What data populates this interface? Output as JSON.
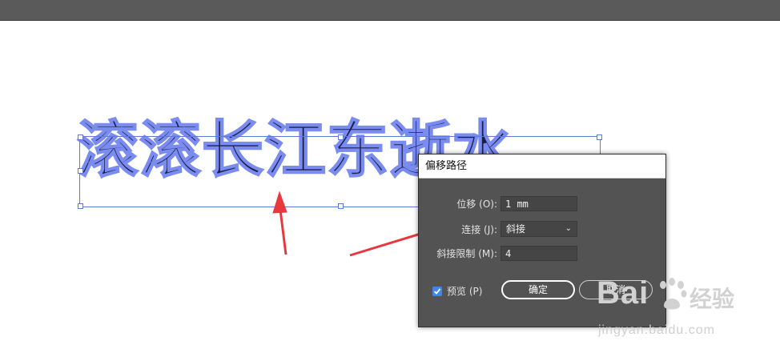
{
  "canvas": {
    "art_text": "滚滚长江东逝水"
  },
  "dialog": {
    "title": "偏移路径",
    "offset": {
      "label": "位移 (O):",
      "value": "1 mm"
    },
    "join": {
      "label": "连接 (J):",
      "value": "斜接"
    },
    "miter_limit": {
      "label": "斜接限制 (M):",
      "value": "4"
    },
    "preview": {
      "label": "预览 (P)",
      "checked": true
    },
    "ok_label": "确定",
    "cancel_label": "取消"
  },
  "watermark": {
    "brand": "Bai",
    "brand_cn": "经验",
    "url": "jingyan.baidu.com"
  },
  "colors": {
    "arrow": "#e8383d",
    "selection": "#5d7bd6",
    "dialog_bg": "#535353",
    "checkbox": "#3f86e6"
  }
}
